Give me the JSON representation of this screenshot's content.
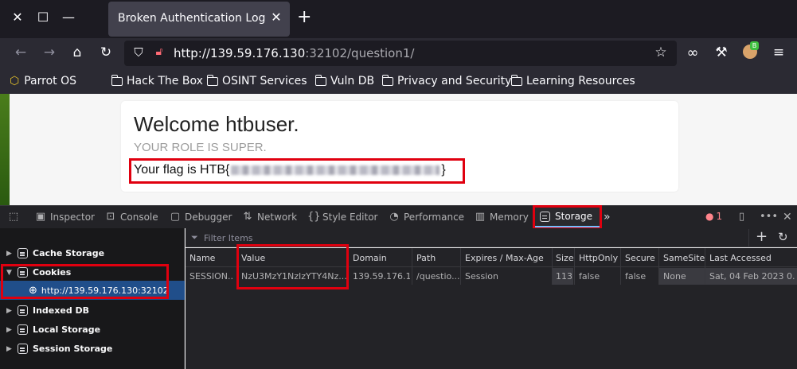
{
  "browser": {
    "tab_title": "Broken Authentication Login",
    "url_host": "http://139.59.176.130",
    "url_rest": ":32102/question1/",
    "profile_badge": "B"
  },
  "bookmarks": [
    {
      "label": "Parrot OS",
      "icon": "parrot-cube-icon"
    },
    {
      "label": "Hack The Box",
      "icon": "folder-icon"
    },
    {
      "label": "OSINT Services",
      "icon": "folder-icon"
    },
    {
      "label": "Vuln DB",
      "icon": "folder-icon"
    },
    {
      "label": "Privacy and Security",
      "icon": "folder-icon"
    },
    {
      "label": "Learning Resources",
      "icon": "folder-icon"
    }
  ],
  "page": {
    "welcome": "Welcome htbuser.",
    "role": "YOUR ROLE IS SUPER.",
    "flag_prefix": "Your flag is HTB{",
    "flag_suffix": "}"
  },
  "devtools": {
    "tabs": [
      {
        "label": "Inspector",
        "icon": "inspector-icon"
      },
      {
        "label": "Console",
        "icon": "console-icon"
      },
      {
        "label": "Debugger",
        "icon": "debugger-icon"
      },
      {
        "label": "Network",
        "icon": "network-icon"
      },
      {
        "label": "Style Editor",
        "icon": "style-editor-icon"
      },
      {
        "label": "Performance",
        "icon": "performance-icon"
      },
      {
        "label": "Memory",
        "icon": "memory-icon"
      },
      {
        "label": "Storage",
        "icon": "storage-icon",
        "active": true
      }
    ],
    "error_count": "1",
    "filter_placeholder": "Filter Items",
    "tree": [
      {
        "label": "Cache Storage",
        "expanded": false
      },
      {
        "label": "Cookies",
        "expanded": true,
        "children": [
          "http://139.59.176.130:32102"
        ]
      },
      {
        "label": "Indexed DB",
        "expanded": false
      },
      {
        "label": "Local Storage",
        "expanded": false
      },
      {
        "label": "Session Storage",
        "expanded": false
      }
    ],
    "columns": [
      "Name",
      "Value",
      "Domain",
      "Path",
      "Expires / Max-Age",
      "Size",
      "HttpOnly",
      "Secure",
      "SameSite",
      "Last Accessed"
    ],
    "rows": [
      [
        "SESSION...",
        "NzU3MzY1NzIzYTY4Nz...",
        "139.59.176.1...",
        "/questio...",
        "Session",
        "113",
        "false",
        "false",
        "None",
        "Sat, 04 Feb 2023 0..."
      ]
    ]
  },
  "colors": {
    "highlight": "#e0000f",
    "selection": "#204e8a",
    "active_tab_underline": "#75bfff"
  }
}
